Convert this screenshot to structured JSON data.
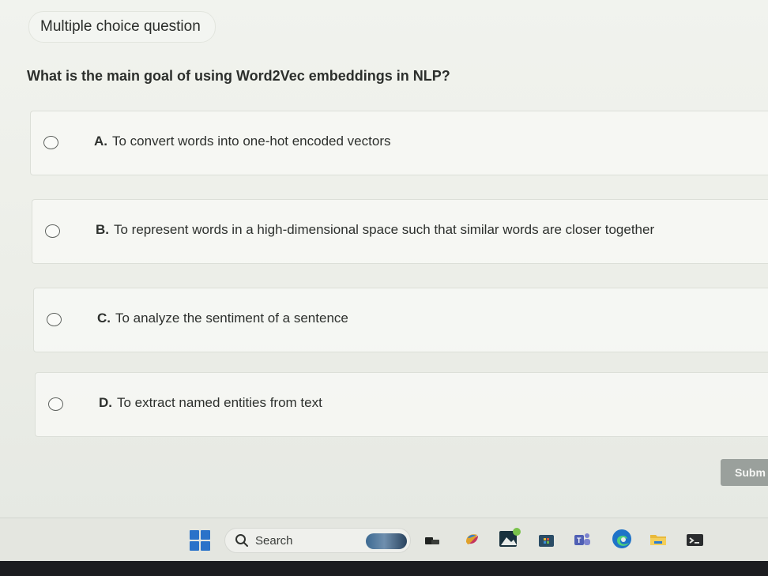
{
  "quiz": {
    "type_label": "Multiple choice question",
    "question": "What is the main goal of using Word2Vec embeddings in NLP?",
    "options": [
      {
        "letter": "A.",
        "text": "To convert words into one-hot encoded vectors"
      },
      {
        "letter": "B.",
        "text": "To represent words in a high-dimensional space such that similar words are closer together"
      },
      {
        "letter": "C.",
        "text": "To analyze the sentiment of a sentence"
      },
      {
        "letter": "D.",
        "text": "To extract named entities from text"
      }
    ],
    "submit_label": "Subm"
  },
  "taskbar": {
    "search_label": "Search",
    "icons": [
      "windows-start-icon",
      "search-icon",
      "widgets-icon",
      "task-view-icon",
      "copilot-icon",
      "photos-icon",
      "store-icon",
      "teams-icon",
      "edge-browser-icon",
      "file-explorer-icon",
      "terminal-icon"
    ]
  },
  "colors": {
    "accent_start": "#2a72c9",
    "submit_bg": "#9aa09c"
  }
}
